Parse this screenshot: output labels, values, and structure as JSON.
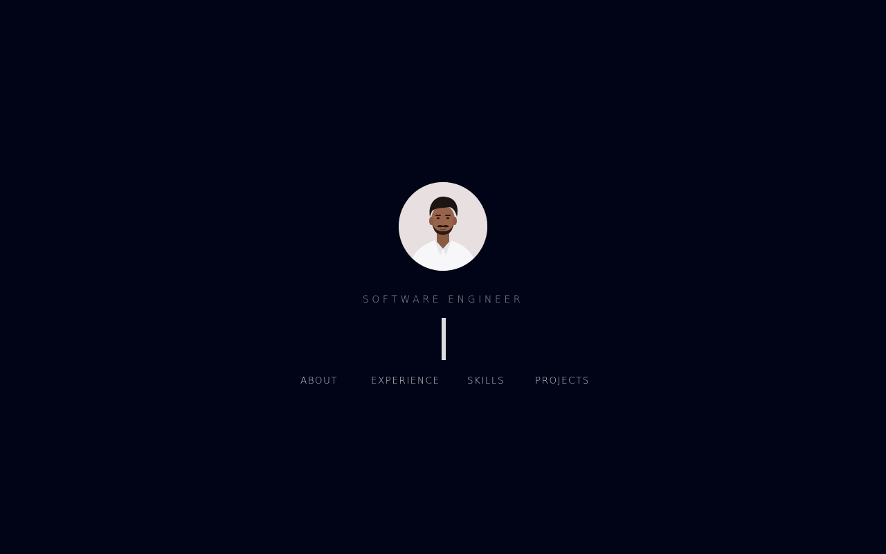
{
  "profile": {
    "role": "SOFTWARE ENGINEER"
  },
  "nav": {
    "items": [
      {
        "label": "ABOUT"
      },
      {
        "label": "EXPERIENCE"
      },
      {
        "label": "SKILLS"
      },
      {
        "label": "PROJECTS"
      }
    ]
  },
  "colors": {
    "background": "#010416",
    "text_muted": "#8d8e9b",
    "nav_text": "#c4c5d0",
    "cursor": "#dcdce0"
  }
}
